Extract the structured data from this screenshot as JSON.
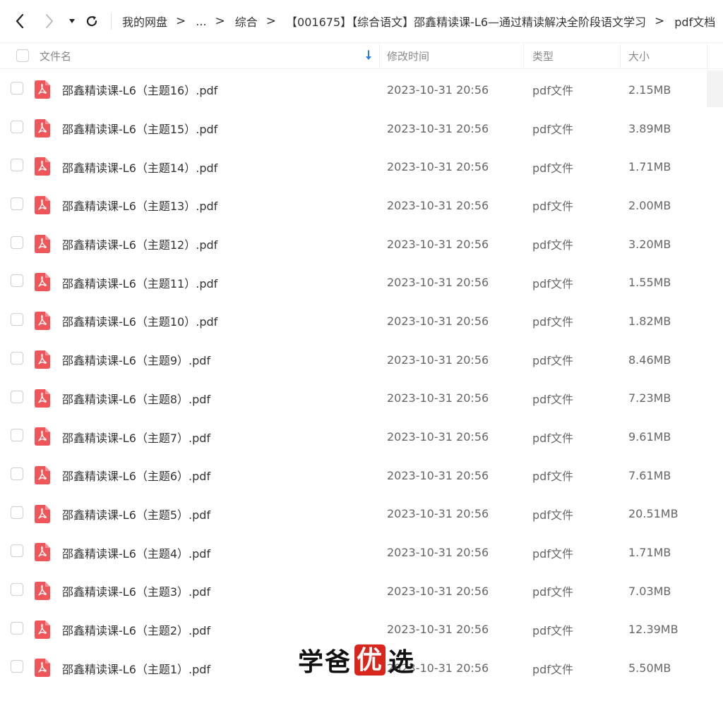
{
  "toolbar": {
    "back_icon": "chevron-left-icon",
    "forward_icon": "chevron-right-icon",
    "history_icon": "caret-down-icon",
    "refresh_icon": "refresh-icon"
  },
  "breadcrumb": {
    "items": [
      "我的网盘",
      "...",
      "综合",
      "【001675】【综合语文】邵鑫精读课-L6—通过精读解决全阶段语文学习",
      "pdf文档"
    ],
    "separator": ">"
  },
  "table": {
    "columns": {
      "name": "文件名",
      "mtime": "修改时间",
      "type": "类型",
      "size": "大小"
    },
    "sort_icon": "sort-down-arrow-icon",
    "rows": [
      {
        "name": "邵鑫精读课-L6（主题16）.pdf",
        "mtime": "2023-10-31 20:56",
        "type": "pdf文件",
        "size": "2.15MB"
      },
      {
        "name": "邵鑫精读课-L6（主题15）.pdf",
        "mtime": "2023-10-31 20:56",
        "type": "pdf文件",
        "size": "3.89MB"
      },
      {
        "name": "邵鑫精读课-L6（主题14）.pdf",
        "mtime": "2023-10-31 20:56",
        "type": "pdf文件",
        "size": "1.71MB"
      },
      {
        "name": "邵鑫精读课-L6（主题13）.pdf",
        "mtime": "2023-10-31 20:56",
        "type": "pdf文件",
        "size": "2.00MB"
      },
      {
        "name": "邵鑫精读课-L6（主题12）.pdf",
        "mtime": "2023-10-31 20:56",
        "type": "pdf文件",
        "size": "3.20MB"
      },
      {
        "name": "邵鑫精读课-L6（主题11）.pdf",
        "mtime": "2023-10-31 20:56",
        "type": "pdf文件",
        "size": "1.55MB"
      },
      {
        "name": "邵鑫精读课-L6（主题10）.pdf",
        "mtime": "2023-10-31 20:56",
        "type": "pdf文件",
        "size": "1.82MB"
      },
      {
        "name": "邵鑫精读课-L6（主题9）.pdf",
        "mtime": "2023-10-31 20:56",
        "type": "pdf文件",
        "size": "8.46MB"
      },
      {
        "name": "邵鑫精读课-L6（主题8）.pdf",
        "mtime": "2023-10-31 20:56",
        "type": "pdf文件",
        "size": "7.23MB"
      },
      {
        "name": "邵鑫精读课-L6（主题7）.pdf",
        "mtime": "2023-10-31 20:56",
        "type": "pdf文件",
        "size": "9.61MB"
      },
      {
        "name": "邵鑫精读课-L6（主题6）.pdf",
        "mtime": "2023-10-31 20:56",
        "type": "pdf文件",
        "size": "7.61MB"
      },
      {
        "name": "邵鑫精读课-L6（主题5）.pdf",
        "mtime": "2023-10-31 20:56",
        "type": "pdf文件",
        "size": "20.51MB"
      },
      {
        "name": "邵鑫精读课-L6（主题4）.pdf",
        "mtime": "2023-10-31 20:56",
        "type": "pdf文件",
        "size": "1.71MB"
      },
      {
        "name": "邵鑫精读课-L6（主题3）.pdf",
        "mtime": "2023-10-31 20:56",
        "type": "pdf文件",
        "size": "7.03MB"
      },
      {
        "name": "邵鑫精读课-L6（主题2）.pdf",
        "mtime": "2023-10-31 20:56",
        "type": "pdf文件",
        "size": "12.39MB"
      },
      {
        "name": "邵鑫精读课-L6（主题1）.pdf",
        "mtime": "2023-10-31 20:56",
        "type": "pdf文件",
        "size": "5.50MB"
      }
    ],
    "file_icon": "pdf-file-icon"
  },
  "colors": {
    "pdf_icon": "#f0555a",
    "sort_arrow": "#2b7de9",
    "watermark_highlight": "#d8261c"
  },
  "watermark": {
    "part1": "学爸",
    "highlight": "优",
    "part2": "选"
  }
}
